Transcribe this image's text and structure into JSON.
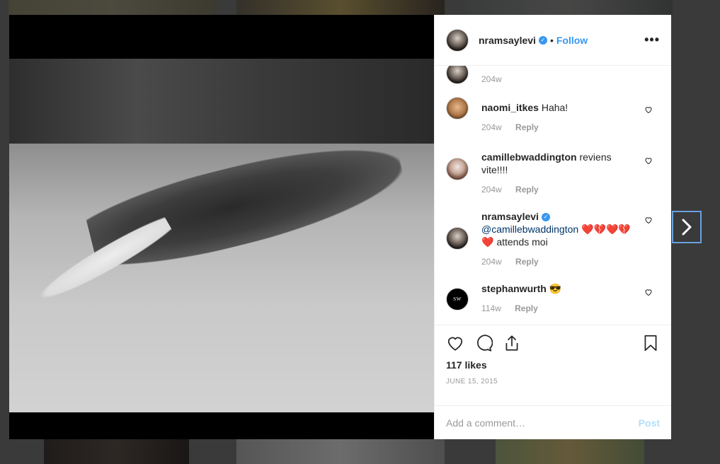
{
  "post": {
    "username": "nramsaylevi",
    "follow_label": "Follow",
    "dot": "•",
    "more_label": "•••",
    "likes": "117 likes",
    "date": "JUNE 15, 2015"
  },
  "comments": [
    {
      "user": "",
      "text": "",
      "time": "204w",
      "reply": ""
    },
    {
      "user": "naomi_itkes",
      "text": "Haha!",
      "time": "204w",
      "reply": "Reply"
    },
    {
      "user": "camillebwaddington",
      "text": "reviens vite!!!!",
      "time": "204w",
      "reply": "Reply"
    },
    {
      "user": "nramsaylevi",
      "mention": "@camillebwaddington",
      "text": "❤️💔❤️💔❤️ attends moi",
      "time": "204w",
      "reply": "Reply"
    },
    {
      "user": "stephanwurth",
      "text": "😎",
      "avatar_text": "SW",
      "time": "114w",
      "reply": "Reply"
    }
  ],
  "add_comment": {
    "placeholder": "Add a comment…",
    "post_label": "Post"
  },
  "colors": {
    "accent": "#3897f0",
    "post_disabled": "#b2dffc"
  },
  "icons": [
    "heart-icon",
    "comment-icon",
    "share-icon",
    "bookmark-icon",
    "chevron-right-icon",
    "verified-icon",
    "more-icon"
  ]
}
